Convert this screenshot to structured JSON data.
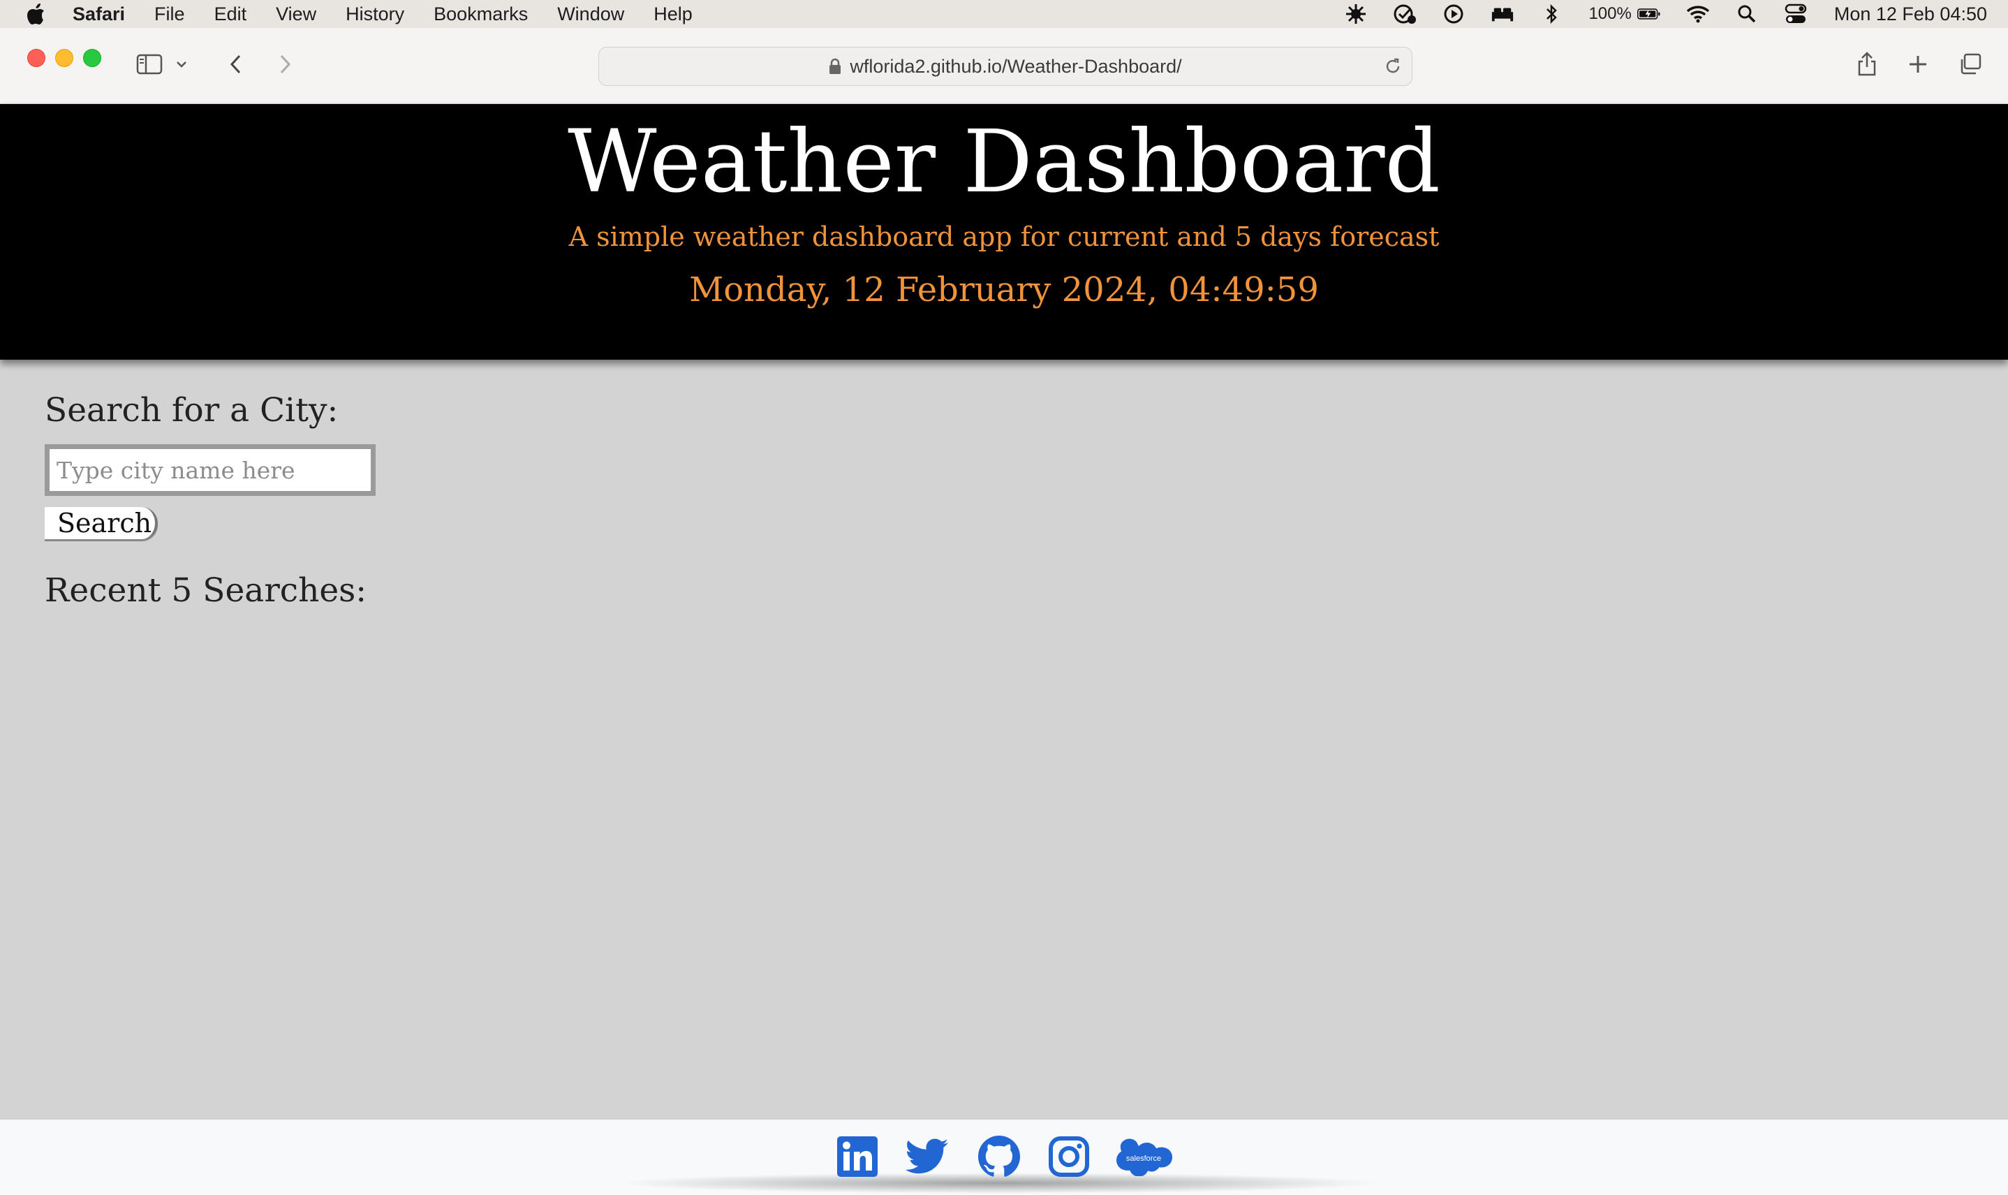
{
  "menubar": {
    "app_name": "Safari",
    "items": [
      "File",
      "Edit",
      "View",
      "History",
      "Bookmarks",
      "Window",
      "Help"
    ],
    "battery": "100%",
    "clock": "Mon 12 Feb  04:50"
  },
  "browser": {
    "url": "wflorida2.github.io/Weather-Dashboard/"
  },
  "header": {
    "title": "Weather Dashboard",
    "subtitle": "A simple weather dashboard app for current and 5 days forecast",
    "datetime": "Monday, 12 February 2024, 04:49:59"
  },
  "search": {
    "heading": "Search for a City:",
    "placeholder": "Type city name here",
    "button_label": "Search",
    "recent_heading": "Recent 5 Searches:"
  },
  "footer": {
    "links": [
      "linkedin-icon",
      "twitter-icon",
      "github-icon",
      "instagram-icon",
      "salesforce-icon"
    ],
    "salesforce_text": "salesforce",
    "icon_color": "#2266d4"
  },
  "colors": {
    "header_bg": "#000000",
    "accent_orange": "#f0933a",
    "page_bg": "#d3d3d3"
  }
}
